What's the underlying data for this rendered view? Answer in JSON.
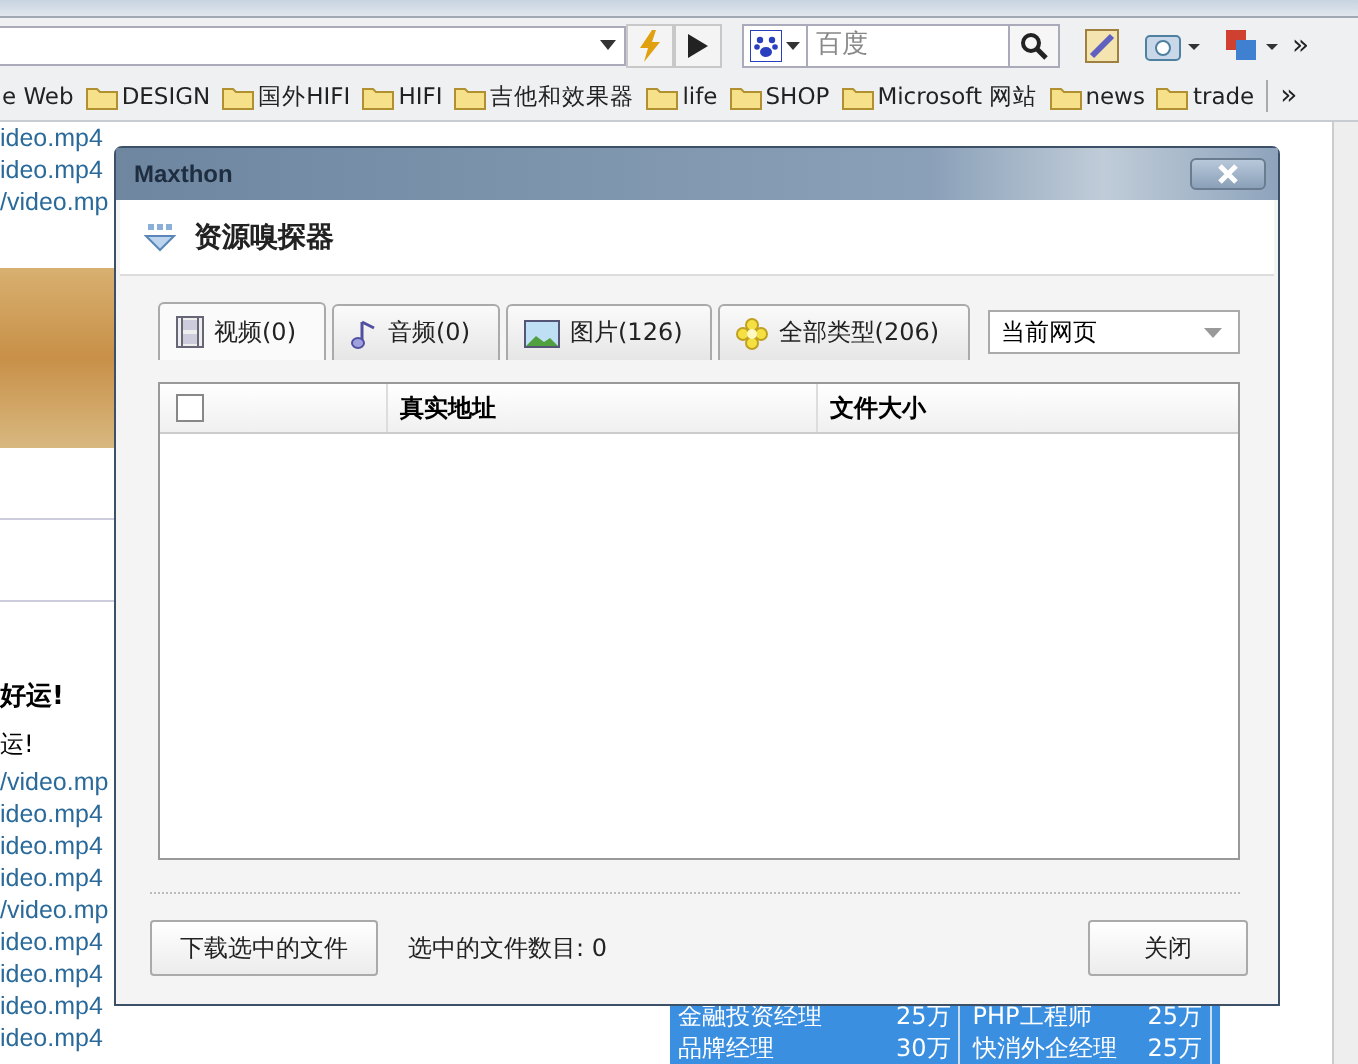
{
  "browser": {
    "search": {
      "placeholder": "百度"
    },
    "overflow": "»",
    "bookmarks": [
      {
        "label": "e Web",
        "kind": "cut"
      },
      {
        "label": "DESIGN",
        "kind": "folder"
      },
      {
        "label": "国外HIFI",
        "kind": "folder"
      },
      {
        "label": "HIFI",
        "kind": "folder"
      },
      {
        "label": "吉他和效果器",
        "kind": "folder"
      },
      {
        "label": "life",
        "kind": "folder"
      },
      {
        "label": "SHOP",
        "kind": "folder"
      },
      {
        "label": "Microsoft 网站",
        "kind": "folder"
      },
      {
        "label": "news",
        "kind": "folder"
      },
      {
        "label": "trade",
        "kind": "folder"
      }
    ],
    "bookmarks_overflow": "»"
  },
  "page": {
    "links_top": [
      "ideo.mp4",
      "ideo.mp4",
      "/video.mp"
    ],
    "heading": "好运!",
    "text": "运!",
    "links": [
      "/video.mp",
      "ideo.mp4",
      "ideo.mp4",
      "ideo.mp4",
      "/video.mp",
      "ideo.mp4",
      "ideo.mp4",
      "ideo.mp4",
      "ideo.mp4"
    ],
    "jobs": [
      {
        "title": "金融投资经理",
        "salary": "25万",
        "title_2": "PHP工程师",
        "salary_2": "25万"
      },
      {
        "title": "品牌经理",
        "salary": "30万",
        "title_2": "快消外企经理",
        "salary_2": "25万"
      }
    ]
  },
  "dialog": {
    "app_title": "Maxthon",
    "title": "资源嗅探器",
    "tabs": [
      {
        "label": "视频(0)",
        "kind": "video",
        "selected": true
      },
      {
        "label": "音频(0)",
        "kind": "audio",
        "selected": false
      },
      {
        "label": "图片(126)",
        "kind": "image",
        "selected": false
      },
      {
        "label": "全部类型(206)",
        "kind": "all",
        "selected": false
      }
    ],
    "scope": "当前网页",
    "table": {
      "select_all_checked": false,
      "columns": [
        "真实地址",
        "文件大小"
      ]
    },
    "download_button": "下载选中的文件",
    "selected_count": "选中的文件数目: 0",
    "close_button": "关闭"
  }
}
